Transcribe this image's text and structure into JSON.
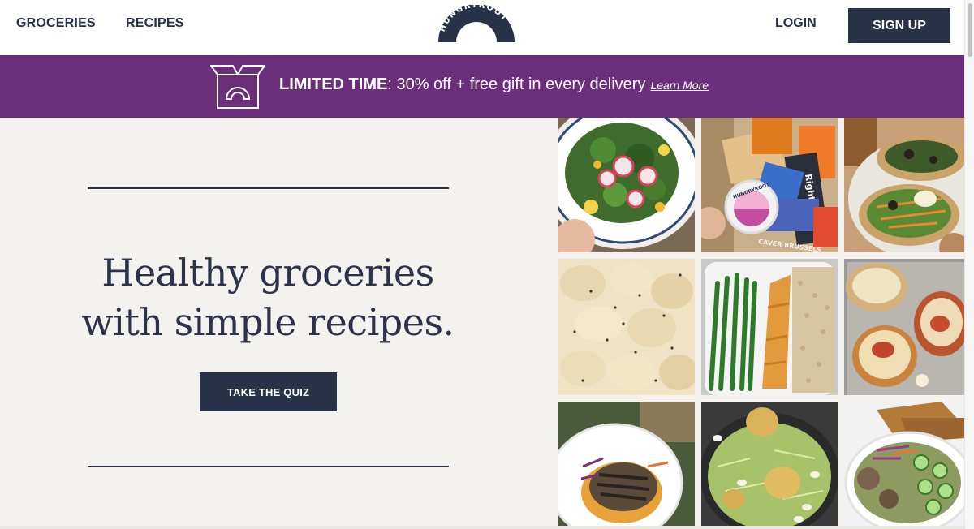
{
  "nav": {
    "groceries": "GROCERIES",
    "recipes": "RECIPES",
    "logo_text": "HUNGRYROOT",
    "login": "LOGIN",
    "signup": "SIGN UP"
  },
  "promo": {
    "bold": "LIMITED TIME",
    "text": ": 30% off + free gift in every delivery",
    "link": "Learn More"
  },
  "hero": {
    "headline_line1": "Healthy groceries",
    "headline_line2": "with simple recipes.",
    "cta": "TAKE THE QUIZ"
  },
  "gallery": {
    "tiles": [
      {
        "name": "radish-salad-photo"
      },
      {
        "name": "grocery-haul-photo",
        "labels": [
          "HUNGRYROOT",
          "RightRice",
          "CAVER BRUSSELS"
        ]
      },
      {
        "name": "tostadas-photo"
      },
      {
        "name": "creamy-pasta-photo"
      },
      {
        "name": "salmon-green-beans-photo"
      },
      {
        "name": "stuffed-peppers-photo"
      },
      {
        "name": "grilled-patty-plate-photo"
      },
      {
        "name": "potato-salad-bowl-photo"
      },
      {
        "name": "crackers-salad-bowl-photo"
      }
    ]
  },
  "colors": {
    "navy": "#283249",
    "promo_purple": "#6a2e7a",
    "background": "#f4f2ee"
  }
}
